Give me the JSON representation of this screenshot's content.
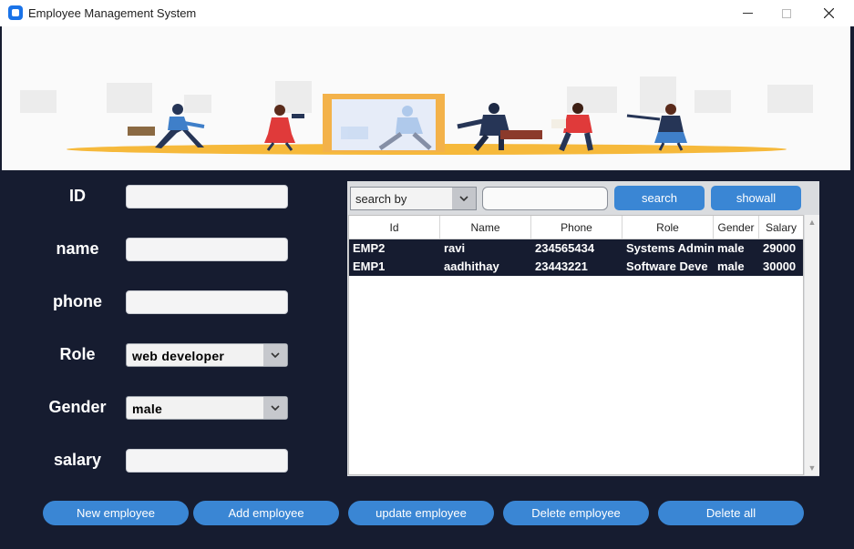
{
  "window": {
    "title": "Employee Management System",
    "icons": [
      "app-icon",
      "minimize-icon",
      "maximize-icon",
      "close-icon"
    ]
  },
  "form": {
    "id_label": "ID",
    "name_label": "name",
    "phone_label": "phone",
    "role_label": "Role",
    "gender_label": "Gender",
    "salary_label": "salary",
    "id_value": "",
    "name_value": "",
    "phone_value": "",
    "salary_value": "",
    "role_selected": "web developer",
    "gender_selected": "male"
  },
  "search": {
    "by_selected": "search by",
    "query": "",
    "search_label": "search",
    "showall_label": "showall"
  },
  "table": {
    "columns": [
      "Id",
      "Name",
      "Phone",
      "Role",
      "Gender",
      "Salary"
    ],
    "rows": [
      [
        "EMP2",
        "ravi",
        "234565434",
        "Systems Admin",
        "male",
        "29000"
      ],
      [
        "EMP1",
        "aadhithay",
        "23443221",
        "Software Deve",
        "male",
        "30000"
      ]
    ]
  },
  "actions": {
    "new": "New employee",
    "add": "Add employee",
    "update": "update employee",
    "delete": "Delete employee",
    "delete_all": "Delete all"
  },
  "colors": {
    "background": "#161c30",
    "accent": "#3a86d4",
    "banner_floor": "#f6b93b"
  }
}
